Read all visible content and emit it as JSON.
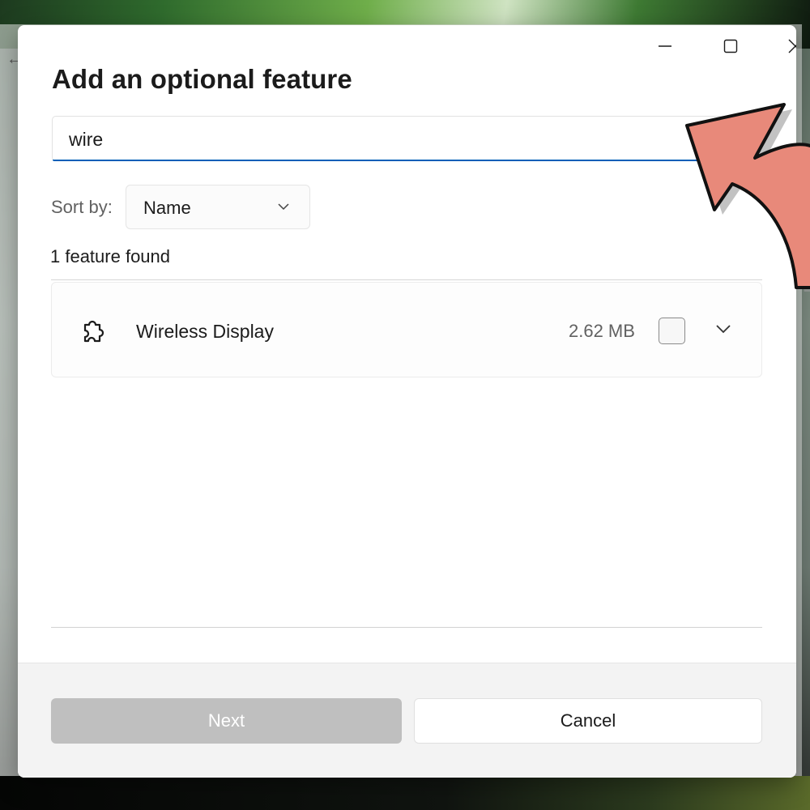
{
  "dialog": {
    "title": "Add an optional feature"
  },
  "search": {
    "value": "wire",
    "underline_color": "#005fb8"
  },
  "sort": {
    "label": "Sort by:",
    "selected": "Name"
  },
  "results": {
    "count_text": "1 feature found",
    "items": [
      {
        "name": "Wireless Display",
        "size": "2.62 MB",
        "checked": false,
        "icon": "puzzle-piece-icon"
      }
    ]
  },
  "footer": {
    "next_label": "Next",
    "cancel_label": "Cancel"
  },
  "window_controls": {
    "icons": [
      "minimize-icon",
      "maximize-icon",
      "close-icon"
    ]
  },
  "annotation": {
    "color": "#e8897a"
  }
}
